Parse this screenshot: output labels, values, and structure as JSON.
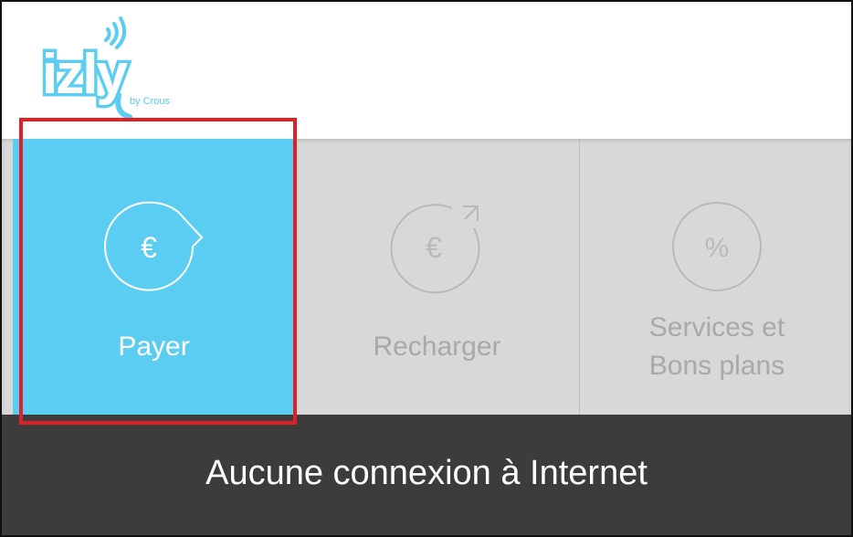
{
  "app": {
    "logo_text": "izly",
    "logo_subtext": "by Crous",
    "brand_color": "#5ccdf2"
  },
  "tiles": [
    {
      "label": "Payer",
      "icon": "euro-pay-icon",
      "selected": true
    },
    {
      "label": "Recharger",
      "icon": "euro-recharge-icon",
      "selected": false
    },
    {
      "label_lines": [
        "Services et",
        "Bons plans"
      ],
      "icon": "percent-icon",
      "selected": false
    }
  ],
  "icons": {
    "euro_symbol": "€",
    "percent_symbol": "%"
  },
  "status": {
    "message": "Aucune connexion à Internet"
  },
  "colors": {
    "selected_tile": "#5ccdf2",
    "inactive_tile": "#d8d8d8",
    "inactive_text": "#a9a9a9",
    "status_bar": "#3c3c3c",
    "highlight": "#e01f26"
  }
}
